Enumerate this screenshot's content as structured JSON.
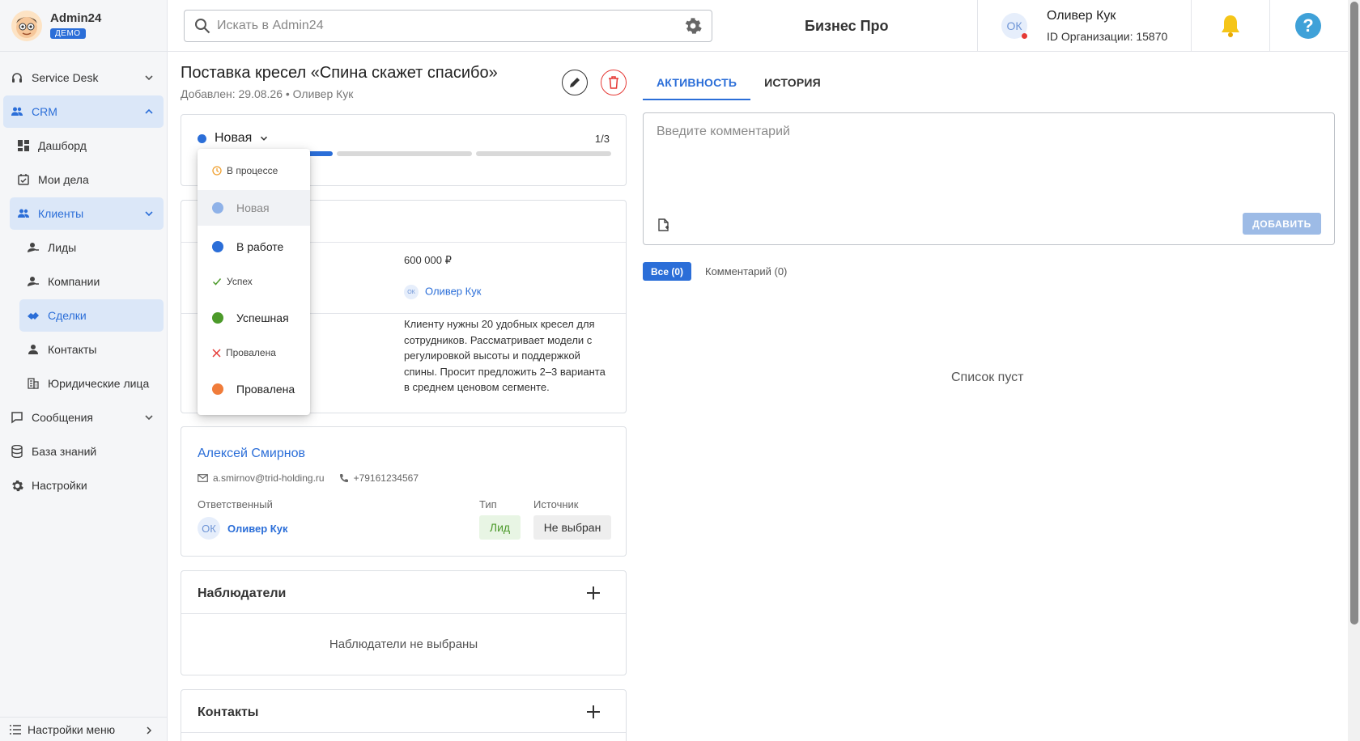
{
  "brand": {
    "name": "Admin24",
    "badge": "ДЕМО"
  },
  "sidebar": {
    "items": [
      {
        "label": "Service Desk"
      },
      {
        "label": "CRM"
      },
      {
        "label": "Дашборд"
      },
      {
        "label": "Мои дела"
      },
      {
        "label": "Клиенты"
      },
      {
        "label": "Лиды"
      },
      {
        "label": "Компании"
      },
      {
        "label": "Сделки"
      },
      {
        "label": "Контакты"
      },
      {
        "label": "Юридические лица"
      },
      {
        "label": "Сообщения"
      },
      {
        "label": "База знаний"
      },
      {
        "label": "Настройки"
      }
    ],
    "bottom_label": "Настройки меню"
  },
  "header": {
    "search_placeholder": "Искать в Admin24",
    "plan": "Бизнес Про",
    "user_initials": "ОК",
    "user_name": "Оливер Кук",
    "org_id": "ID Организации: 15870",
    "help": "?"
  },
  "deal": {
    "title": "Поставка кресел «Спина скажет спасибо»",
    "subtitle": "Добавлен: 29.08.26 • Оливер Кук",
    "status": "Новая",
    "stage_count": "1/3",
    "progress": {
      "filled_segments": 1,
      "total_segments": 3
    },
    "amount": "600 000 ₽",
    "owner_initials": "ОК",
    "owner": "Оливер Кук",
    "description": "Клиенту нужны 20 удобных кресел для сотрудников. Рассматривает модели с регулировкой высоты и поддержкой спины. Просит предложить 2–3 варианта в среднем ценовом сегменте."
  },
  "status_menu": {
    "group_in_progress": "В процессе",
    "item_new": "Новая",
    "item_in_work": "В работе",
    "group_success": "Успех",
    "item_success": "Успешная",
    "group_failed": "Провалена",
    "item_failed": "Провалена"
  },
  "contact": {
    "name": "Алексей Смирнов",
    "email": "a.smirnov@trid-holding.ru",
    "phone": "+79161234567",
    "responsible_label": "Ответственный",
    "responsible_initials": "ОК",
    "responsible_name": "Оливер Кук",
    "type_label": "Тип",
    "type_value": "Лид",
    "source_label": "Источник",
    "source_value": "Не выбран"
  },
  "observers": {
    "title": "Наблюдатели",
    "empty": "Наблюдатели не выбраны"
  },
  "contacts_section": {
    "title": "Контакты"
  },
  "activity": {
    "tab_activity": "АКТИВНОСТЬ",
    "tab_history": "ИСТОРИЯ",
    "comment_placeholder": "Введите комментарий",
    "add_button": "ДОБАВИТЬ",
    "filter_all": "Все (0)",
    "filter_comments": "Комментарий (0)",
    "empty_list": "Список пуст"
  },
  "colors": {
    "accent": "#2b6ed8",
    "status_new": "#8fb2e8",
    "status_in_work": "#2b6ed8",
    "status_success": "#4c9a2a",
    "status_failed": "#f07c3a",
    "danger": "#e53935"
  }
}
